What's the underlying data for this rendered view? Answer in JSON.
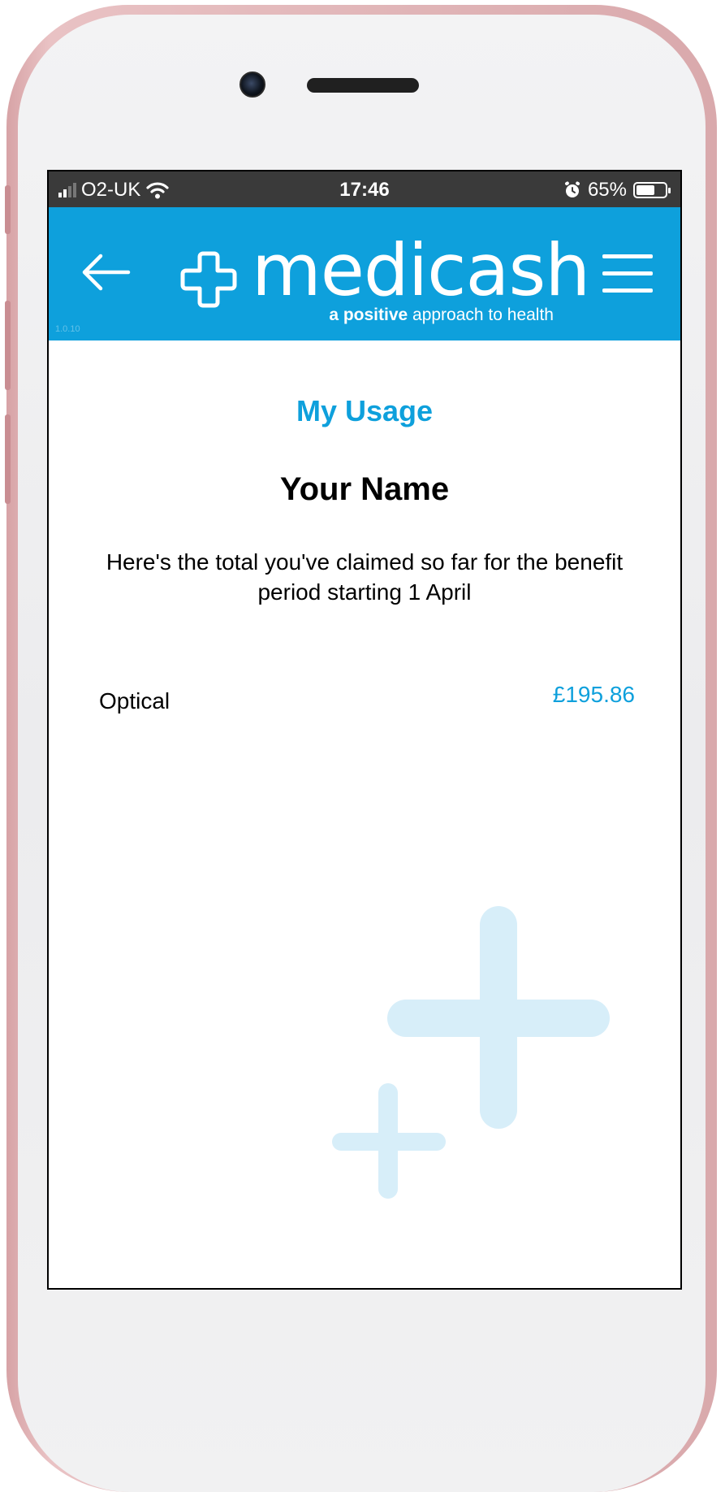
{
  "status_bar": {
    "carrier": "O2-UK",
    "time": "17:46",
    "battery_percent": "65%",
    "battery_level": 0.65
  },
  "header": {
    "logo_text": "medicash",
    "tagline_bold": "a positive",
    "tagline_rest": " approach to health",
    "version": "1.0.10",
    "back_icon": "arrow-left-icon",
    "menu_icon": "hamburger-menu-icon"
  },
  "main": {
    "title": "My Usage",
    "user_name": "Your Name",
    "intro": "Here's the total you've claimed so far for the benefit period starting 1 April",
    "usage": [
      {
        "category": "Optical",
        "amount": "£195.86"
      }
    ]
  },
  "colors": {
    "brand_blue": "#0ea0dc",
    "decor_blue": "#d7eef9",
    "status_bar": "#3a3a3a"
  }
}
